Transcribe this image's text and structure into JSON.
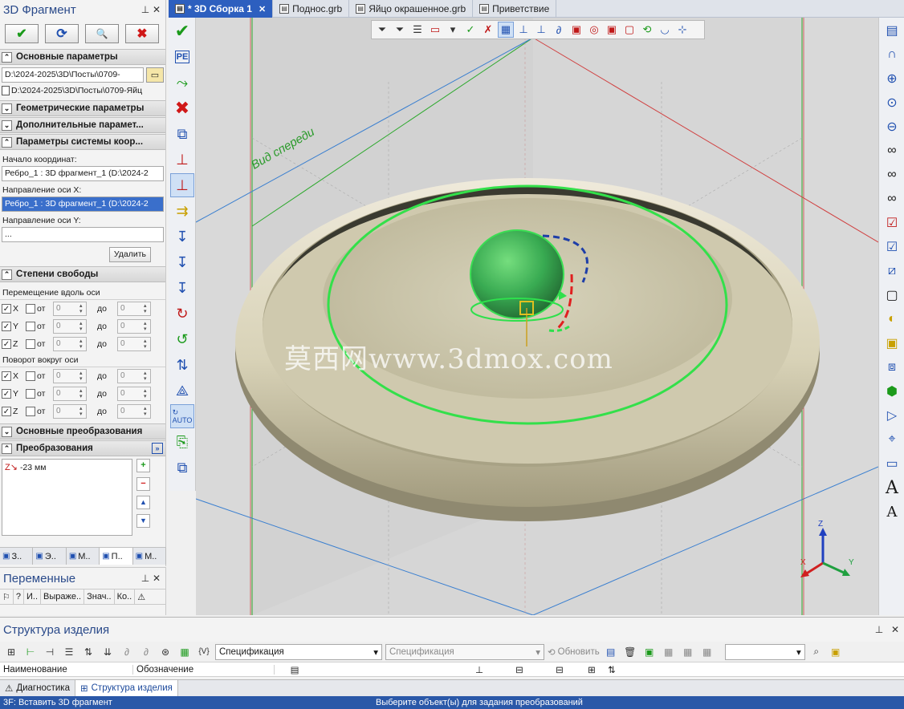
{
  "left_panel": {
    "title": "3D Фрагмент",
    "pin": "⊥",
    "close": "✕",
    "actions": {
      "ok": "✔",
      "refresh": "⟳",
      "preview": "🔍",
      "cancel": "✖"
    },
    "sections": {
      "main_params": "Основные параметры",
      "geom_params": "Геометрические параметры",
      "extra_params": "Дополнительные парамет...",
      "coord_params": "Параметры системы коор...",
      "dof": "Степени свободы",
      "main_transforms": "Основные преобразования",
      "transforms": "Преобразования"
    },
    "file_path": "D:\\2024-2025\\3D\\Посты\\0709-",
    "file_path2": "D:\\2024-2025\\3D\\Посты\\0709-Яйц",
    "origin_label": "Начало координат:",
    "origin_value": "Ребро_1 : 3D фрагмент_1 (D:\\2024-2",
    "axis_x_label": "Направление оси X:",
    "axis_x_value": "Ребро_1 : 3D фрагмент_1 (D:\\2024-2",
    "axis_y_label": "Направление оси Y:",
    "axis_y_value": "...",
    "delete_label": "Удалить",
    "move_group": "Перемещение вдоль оси",
    "rot_group": "Поворот вокруг оси",
    "dof_rows_move": [
      {
        "axis": "X",
        "from": "от",
        "from_val": "0",
        "to": "до",
        "to_val": "0"
      },
      {
        "axis": "Y",
        "from": "от",
        "from_val": "0",
        "to": "до",
        "to_val": "0"
      },
      {
        "axis": "Z",
        "from": "от",
        "from_val": "0",
        "to": "до",
        "to_val": "0"
      }
    ],
    "dof_rows_rot": [
      {
        "axis": "X",
        "from": "от",
        "from_val": "0",
        "to": "до",
        "to_val": "0"
      },
      {
        "axis": "Y",
        "from": "от",
        "from_val": "0",
        "to": "до",
        "to_val": "0"
      },
      {
        "axis": "Z",
        "from": "от",
        "from_val": "0",
        "to": "до",
        "to_val": "0"
      }
    ],
    "transform_item": "-23 мм",
    "panel_tabs": [
      "З..",
      "Э..",
      "М..",
      "П..",
      "М.."
    ]
  },
  "tabs": [
    {
      "label": "* 3D Сборка 1",
      "active": true
    },
    {
      "label": "Поднос.grb",
      "active": false
    },
    {
      "label": "Яйцо окрашенное.grb",
      "active": false
    },
    {
      "label": "Приветствие",
      "active": false
    }
  ],
  "viewport": {
    "view_label": "Вид спереди",
    "watermark": "莫西网www.3dmox.com",
    "axis_x": "X",
    "axis_y": "Y",
    "axis_z": "Z"
  },
  "variables_panel": {
    "title": "Переменные",
    "columns": [
      "?",
      "И..",
      "Выраже..",
      "Знач..",
      "Ко.."
    ]
  },
  "structure_panel": {
    "title": "Структура изделия",
    "spec_dropdown": "Спецификация",
    "spec_dropdown2": "Спецификация",
    "refresh_label": "Обновить",
    "fx_label": "{V}",
    "columns": [
      "Наименование",
      "Обозначение"
    ]
  },
  "bottom_tabs": [
    {
      "label": "Диагностика",
      "active": false
    },
    {
      "label": "Структура изделия",
      "active": true
    }
  ],
  "status": {
    "left": "3F: Вставить 3D фрагмент",
    "center": "Выберите объект(ы) для задания преобразований"
  },
  "colors": {
    "accent": "#2d5fbf",
    "selection_green": "#33e04a",
    "status_bar": "#2a58a8"
  }
}
